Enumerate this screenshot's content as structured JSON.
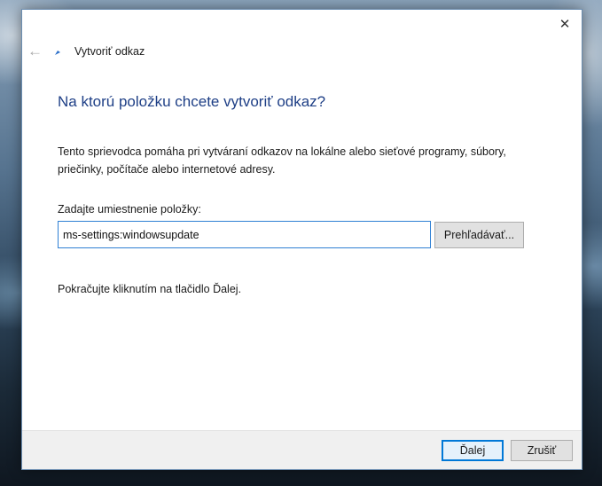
{
  "dialog": {
    "title": "Vytvoriť odkaz",
    "close_icon": "close-icon",
    "back_icon": "back-arrow-icon",
    "heading": "Na ktorú položku chcete vytvoriť odkaz?",
    "description": "Tento sprievodca pomáha pri vytváraní odkazov na lokálne alebo sieťové programy, súbory, priečinky, počítače alebo internetové adresy.",
    "location_label": "Zadajte umiestnenie položky:",
    "location_value": "ms-settings:windowsupdate",
    "browse_label": "Prehľadávať...",
    "continue_hint": "Pokračujte kliknutím na tlačidlo Ďalej.",
    "next_label": "Ďalej",
    "cancel_label": "Zrušiť"
  },
  "colors": {
    "heading": "#1e3f86",
    "accent": "#0078d7",
    "dialog_border": "#6b8db0"
  }
}
